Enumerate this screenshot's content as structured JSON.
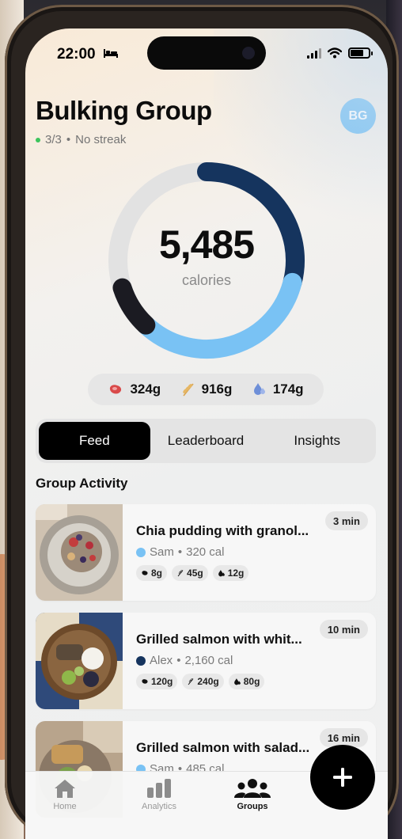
{
  "status_bar": {
    "time": "22:00"
  },
  "header": {
    "title": "Bulking Group",
    "progress": "3/3",
    "separator": "•",
    "streak": "No streak",
    "avatar_initials": "BG"
  },
  "calorie_ring": {
    "value": "5,485",
    "label": "calories",
    "segments": [
      {
        "name": "protein",
        "fraction": 0.29,
        "color": "#15345e"
      },
      {
        "name": "carbs",
        "fraction": 0.33,
        "color": "#79c2f4"
      },
      {
        "name": "fat",
        "fraction": 0.08,
        "color": "#1b1b22"
      }
    ],
    "track_color": "#e2e2e2"
  },
  "macros": [
    {
      "icon": "protein-icon",
      "value": "324g"
    },
    {
      "icon": "carbs-icon",
      "value": "916g"
    },
    {
      "icon": "fat-icon",
      "value": "174g"
    }
  ],
  "tabs": [
    {
      "label": "Feed",
      "active": true
    },
    {
      "label": "Leaderboard",
      "active": false
    },
    {
      "label": "Insights",
      "active": false
    }
  ],
  "section_title": "Group Activity",
  "feed": [
    {
      "name": "Chia pudding with granol...",
      "time": "3 min",
      "user": "Sam",
      "user_color": "#79c2f4",
      "calories": "320 cal",
      "protein": "8g",
      "carbs": "45g",
      "fat": "12g"
    },
    {
      "name": "Grilled salmon with whit...",
      "time": "10 min",
      "user": "Alex",
      "user_color": "#15345e",
      "calories": "2,160 cal",
      "protein": "120g",
      "carbs": "240g",
      "fat": "80g"
    },
    {
      "name": "Grilled salmon with salad...",
      "time": "16 min",
      "user": "Sam",
      "user_color": "#79c2f4",
      "calories": "485 cal",
      "protein": "",
      "carbs": "",
      "fat": ""
    }
  ],
  "tabbar": [
    {
      "label": "Home",
      "icon": "home-icon",
      "active": false
    },
    {
      "label": "Analytics",
      "icon": "bar-chart-icon",
      "active": false
    },
    {
      "label": "Groups",
      "icon": "group-icon",
      "active": true
    }
  ],
  "fab": {
    "icon": "plus-icon",
    "label": "+"
  }
}
